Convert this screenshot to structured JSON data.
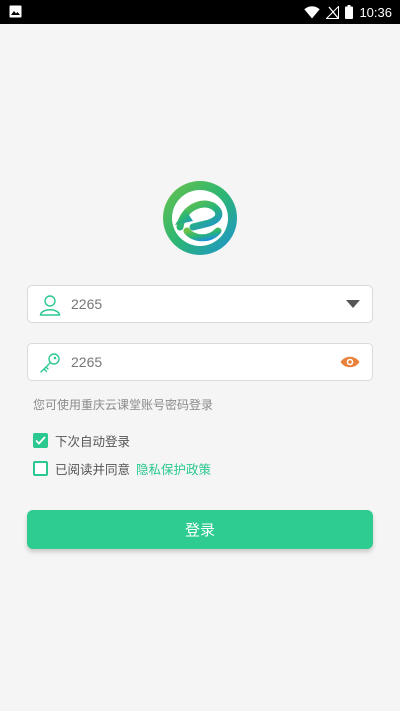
{
  "status_bar": {
    "time": "10:36",
    "icons": [
      "image-icon",
      "wifi-icon",
      "no-signal-icon",
      "battery-icon"
    ]
  },
  "logo": {
    "name": "chongqing-cloud-classroom-logo"
  },
  "form": {
    "username": {
      "value": "2265",
      "icon": "user-icon",
      "trailing_icon": "dropdown-arrow-icon"
    },
    "password": {
      "value": "2265",
      "icon": "key-icon",
      "trailing_icon": "eye-icon"
    },
    "hint": "您可使用重庆云课堂账号密码登录",
    "auto_login": {
      "label": "下次自动登录",
      "checked": true
    },
    "agreement": {
      "label": "已阅读并同意",
      "link_text": "隐私保护政策",
      "checked": false
    },
    "login_button": "登录"
  },
  "colors": {
    "accent": "#2ecc91",
    "eye_icon": "#e8813a",
    "background": "#f5f5f5"
  }
}
